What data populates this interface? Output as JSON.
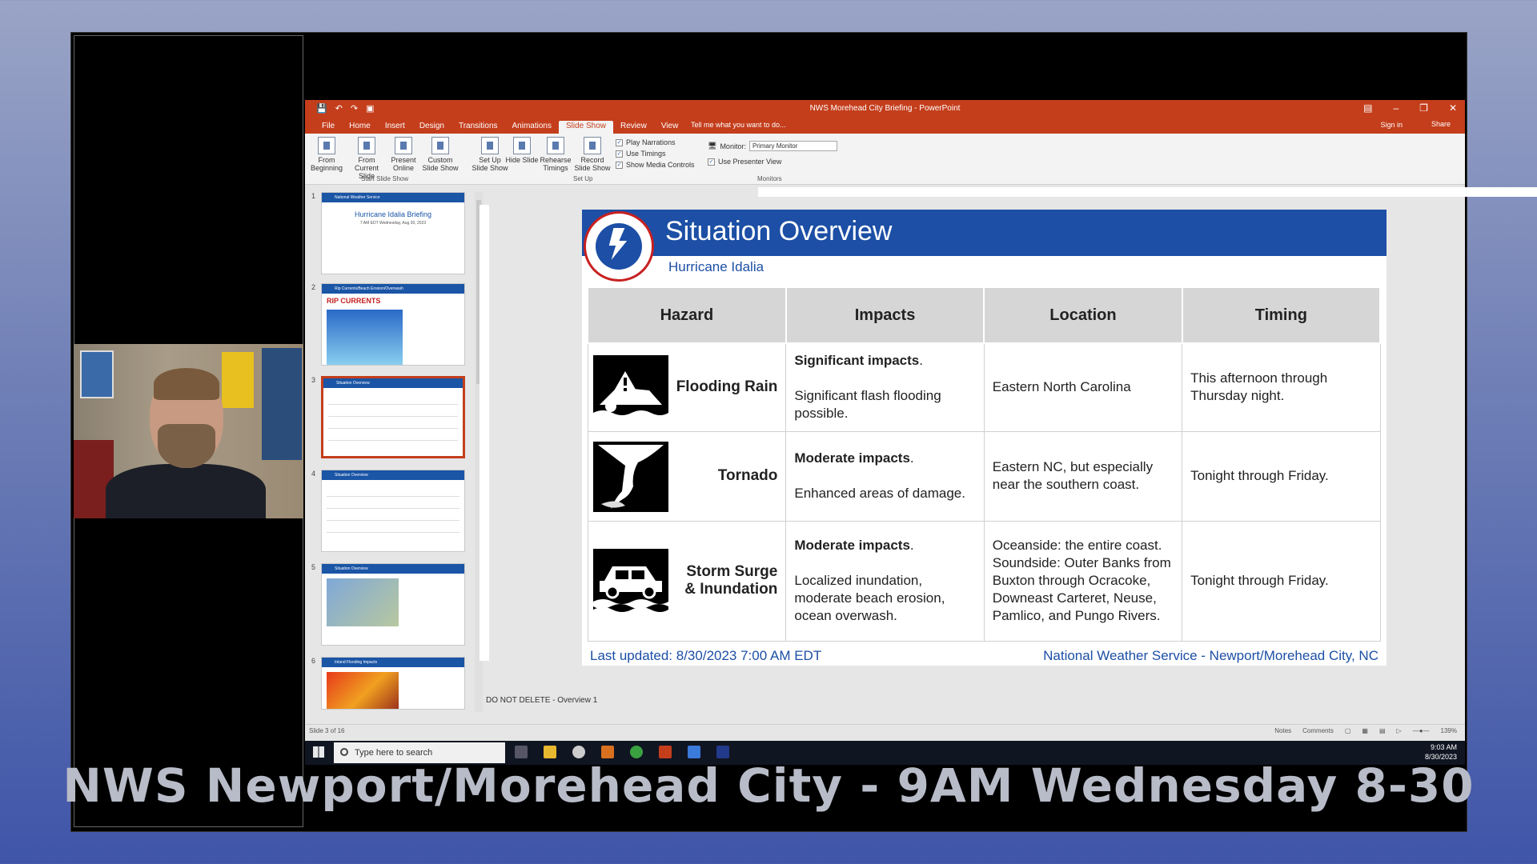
{
  "app": {
    "window_title": "NWS Morehead City Briefing - PowerPoint",
    "tabs": [
      "File",
      "Home",
      "Insert",
      "Design",
      "Transitions",
      "Animations",
      "Slide Show",
      "Review",
      "View"
    ],
    "active_tab": "Slide Show",
    "tell_me": "Tell me what you want to do...",
    "sign_in": "Sign in",
    "share": "Share"
  },
  "ribbon": {
    "buttons": [
      {
        "label": "From Beginning"
      },
      {
        "label": "From Current Slide"
      },
      {
        "label": "Present Online"
      },
      {
        "label": "Custom Slide Show"
      },
      {
        "label": "Set Up Slide Show"
      },
      {
        "label": "Hide Slide"
      },
      {
        "label": "Rehearse Timings"
      },
      {
        "label": "Record Slide Show"
      }
    ],
    "group_start": "Start Slide Show",
    "group_setup": "Set Up",
    "group_monitors": "Monitors",
    "checks": [
      "Play Narrations",
      "Use Timings",
      "Show Media Controls"
    ],
    "monitor_label": "Monitor:",
    "monitor_value": "Primary Monitor",
    "presenter_view": "Use Presenter View"
  },
  "thumbnails": [
    {
      "num": "1",
      "header": "National Weather Service",
      "title": "Hurricane Idalia Briefing",
      "sub": "7 AM EDT Wednesday, Aug 30, 2023"
    },
    {
      "num": "2",
      "header": "Rip Currents/Beach Erosion/Overwash",
      "title": "RIP CURRENTS",
      "sub": ""
    },
    {
      "num": "3",
      "header": "Situation Overview",
      "title": "",
      "sub": ""
    },
    {
      "num": "4",
      "header": "Situation Overview",
      "title": "",
      "sub": ""
    },
    {
      "num": "5",
      "header": "Situation Overview",
      "title": "",
      "sub": ""
    },
    {
      "num": "6",
      "header": "Inland Flooding Impacts",
      "title": "",
      "sub": ""
    }
  ],
  "slide": {
    "title": "Situation Overview",
    "subtitle": "Hurricane Idalia",
    "headers": [
      "Hazard",
      "Impacts",
      "Location",
      "Timing"
    ],
    "rows": [
      {
        "hazard": "Flooding Rain",
        "impact_bold": "Significant impacts",
        "impact_text": "Significant flash flooding possible.",
        "location": "Eastern North Carolina",
        "timing": "This afternoon through Thursday night.",
        "icon": "flood-car-icon"
      },
      {
        "hazard": "Tornado",
        "impact_bold": "Moderate impacts",
        "impact_text": "Enhanced areas of damage.",
        "location": "Eastern NC, but especially near the southern coast.",
        "timing": "Tonight through Friday.",
        "icon": "tornado-icon"
      },
      {
        "hazard": "Storm Surge & Inundation",
        "impact_bold": "Moderate impacts",
        "impact_text": "Localized inundation, moderate beach erosion, ocean overwash.",
        "location": "Oceanside: the entire coast. Soundside: Outer Banks from Buxton through Ocracoke, Downeast Carteret, Neuse, Pamlico, and Pungo Rivers.",
        "timing": "Tonight through Friday.",
        "icon": "storm-surge-icon"
      }
    ],
    "footer_left": "Last updated: 8/30/2023 7:00 AM EDT",
    "footer_right": "National Weather Service - Newport/Morehead City, NC"
  },
  "notes_text": "DO NOT DELETE - Overview 1",
  "status": {
    "slide_of": "Slide 3 of 16",
    "notes": "Notes",
    "comments": "Comments",
    "zoom": "139%"
  },
  "taskbar": {
    "search_placeholder": "Type here to search",
    "time": "9:03 AM",
    "date": "8/30/2023"
  },
  "caption": "NWS Newport/Morehead City - 9AM Wednesday 8-30"
}
